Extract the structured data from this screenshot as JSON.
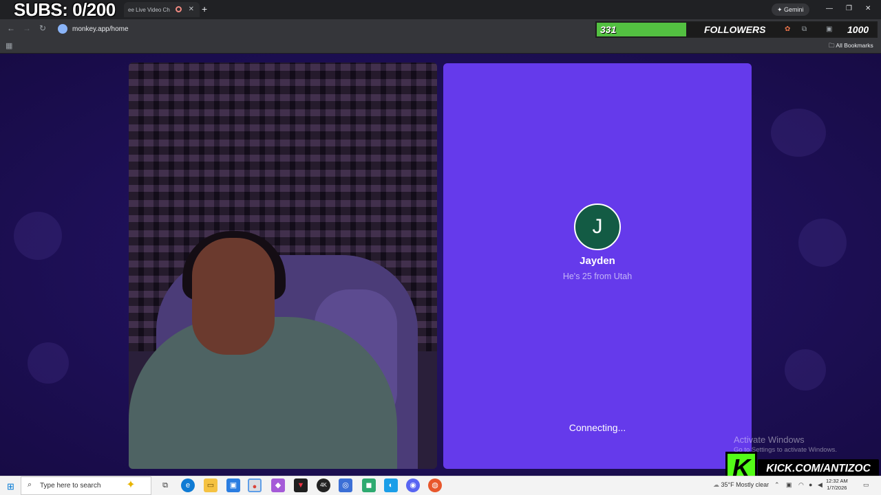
{
  "overlay": {
    "subs_text": "SUBS: 0/200",
    "followers_count": "331",
    "followers_label": "FOLLOWERS",
    "followers_goal": "1000",
    "followers_progress": 0.331,
    "kick_badge_text": "KICK.COM/ANTIZOC"
  },
  "browser": {
    "tab_title": "ee Live Video Ch",
    "new_tab": "+",
    "gemini_label": "Gemini",
    "url": "monkey.app/home",
    "all_bookmarks": "All Bookmarks"
  },
  "partner": {
    "avatar_letter": "J",
    "name": "Jayden",
    "info": "He's 25 from Utah",
    "status": "Connecting..."
  },
  "windows": {
    "activate_title": "Activate Windows",
    "activate_sub": "Go to Settings to activate Windows.",
    "search_placeholder": "Type here to search",
    "weather": "35°F  Mostly clear",
    "time": "12:32 AM",
    "date": "1/7/2026"
  },
  "colors": {
    "partner_panel": "#653aeb",
    "avatar_bg": "#135b44",
    "page_bg": "#1d0f55",
    "followers_bar": "#53c041",
    "kick_green": "#53fc18"
  }
}
